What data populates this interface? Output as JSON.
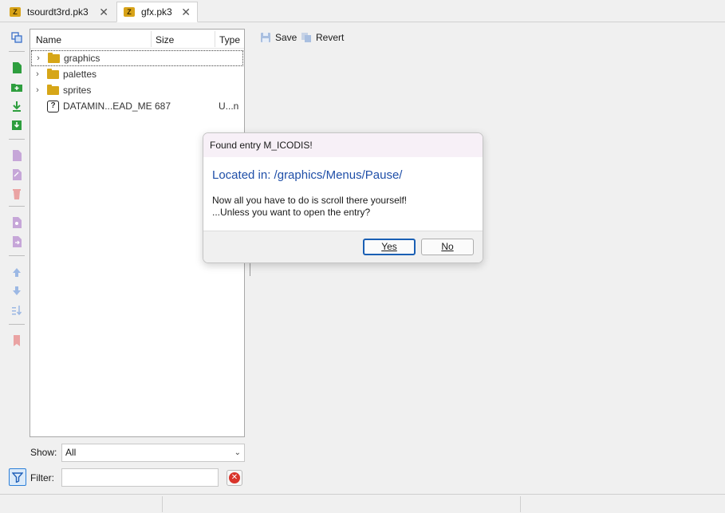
{
  "tabs": [
    {
      "label": "tsourdt3rd.pk3",
      "icon": "pk3-archive-icon"
    },
    {
      "label": "gfx.pk3",
      "icon": "pk3-archive-icon",
      "active": true
    }
  ],
  "entry_list": {
    "columns": [
      "Name",
      "Size",
      "Type"
    ],
    "rows": [
      {
        "name": "graphics",
        "size": "",
        "type": "",
        "kind": "folder"
      },
      {
        "name": "palettes",
        "size": "",
        "type": "",
        "kind": "folder"
      },
      {
        "name": "sprites",
        "size": "",
        "type": "",
        "kind": "folder"
      },
      {
        "name": "DATAMIN...EAD_ME",
        "size": "687",
        "type": "U...n",
        "kind": "unknown"
      }
    ]
  },
  "show": {
    "label": "Show:",
    "value": "All"
  },
  "filter": {
    "label": "Filter:",
    "value": ""
  },
  "entry_toolbar": {
    "save_label": "Save",
    "revert_label": "Revert"
  },
  "dialog": {
    "title": "Found entry M_ICODIS!",
    "heading": "Located in: /graphics/Menus/Pause/",
    "line1": "Now all you have to do is scroll there yourself!",
    "line2": "...Unless you want to open the entry?",
    "yes_label": "Yes",
    "no_label": "No"
  },
  "colors": {
    "accent": "#1a5fb4",
    "heading": "#1f4fa8",
    "folder": "#d6a618"
  }
}
